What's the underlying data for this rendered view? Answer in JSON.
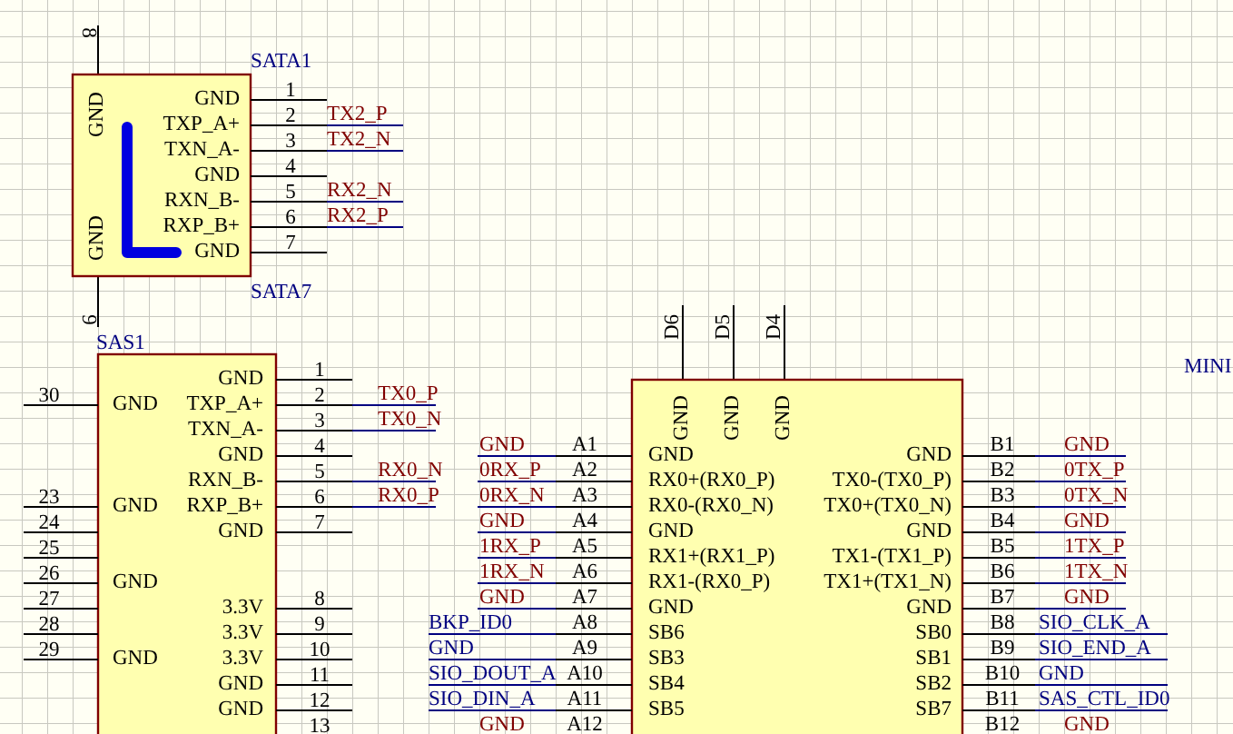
{
  "sata": {
    "designator_top": "SATA1",
    "designator_bottom": "SATA7",
    "top_pin": "8",
    "bottom_pin": "9",
    "side_labels": [
      "GND",
      "GND"
    ],
    "pins": [
      {
        "number": "1",
        "name": "GND"
      },
      {
        "number": "2",
        "name": "TXP_A+",
        "net": {
          "text": "TX2_P",
          "kind": "net_label"
        }
      },
      {
        "number": "3",
        "name": "TXN_A-",
        "net": {
          "text": "TX2_N",
          "kind": "net_label"
        }
      },
      {
        "number": "4",
        "name": "GND"
      },
      {
        "number": "5",
        "name": "RXN_B-",
        "net": {
          "text": "RX2_N",
          "kind": "net_label"
        }
      },
      {
        "number": "6",
        "name": "RXP_B+",
        "net": {
          "text": "RX2_P",
          "kind": "net_label"
        }
      },
      {
        "number": "7",
        "name": "GND"
      }
    ]
  },
  "sas": {
    "designator": "SAS1",
    "rows": [
      {
        "right": {
          "number": "1",
          "name": "GND"
        }
      },
      {
        "left": {
          "number": "30",
          "name": "GND"
        },
        "right": {
          "number": "2",
          "name": "TXP_A+",
          "net": {
            "text": "TX0_P",
            "kind": "net_label"
          }
        }
      },
      {
        "right": {
          "number": "3",
          "name": "TXN_A-",
          "net": {
            "text": "TX0_N",
            "kind": "net_label"
          }
        }
      },
      {
        "right": {
          "number": "4",
          "name": "GND"
        }
      },
      {
        "right": {
          "number": "5",
          "name": "RXN_B-",
          "net": {
            "text": "RX0_N",
            "kind": "net_label"
          }
        }
      },
      {
        "left": {
          "number": "23",
          "name": "GND"
        },
        "right": {
          "number": "6",
          "name": "RXP_B+",
          "net": {
            "text": "RX0_P",
            "kind": "net_label"
          }
        }
      },
      {
        "left": {
          "number": "24"
        },
        "right": {
          "number": "7",
          "name": "GND"
        }
      },
      {
        "left": {
          "number": "25"
        }
      },
      {
        "left": {
          "number": "26",
          "name": "GND"
        }
      },
      {
        "left": {
          "number": "27"
        },
        "right": {
          "number": "8",
          "name": "3.3V"
        }
      },
      {
        "left": {
          "number": "28"
        },
        "right": {
          "number": "9",
          "name": "3.3V"
        }
      },
      {
        "left": {
          "number": "29",
          "name": "GND"
        },
        "right": {
          "number": "10",
          "name": "3.3V"
        }
      },
      {
        "right": {
          "number": "11",
          "name": "GND"
        }
      },
      {
        "right": {
          "number": "12",
          "name": "GND"
        }
      },
      {
        "right": {
          "number": "13"
        }
      }
    ]
  },
  "minisas": {
    "title": "MINI",
    "top_pins": [
      {
        "number": "D6",
        "name": "GND"
      },
      {
        "number": "D5",
        "name": "GND"
      },
      {
        "number": "D4",
        "name": "GND"
      }
    ],
    "rows": [
      {
        "left": {
          "number": "A1",
          "name": "GND",
          "net": {
            "text": "GND",
            "kind": "net_label"
          }
        },
        "right": {
          "number": "B1",
          "name": "GND",
          "net": {
            "text": "GND",
            "kind": "net_label"
          }
        }
      },
      {
        "left": {
          "number": "A2",
          "name": "RX0+(RX0_P)",
          "net": {
            "text": "0RX_P",
            "kind": "net_label"
          }
        },
        "right": {
          "number": "B2",
          "name": "TX0-(TX0_P)",
          "net": {
            "text": "0TX_P",
            "kind": "net_label"
          }
        }
      },
      {
        "left": {
          "number": "A3",
          "name": "RX0-(RX0_N)",
          "net": {
            "text": "0RX_N",
            "kind": "net_label"
          }
        },
        "right": {
          "number": "B3",
          "name": "TX0+(TX0_N)",
          "net": {
            "text": "0TX_N",
            "kind": "net_label"
          }
        }
      },
      {
        "left": {
          "number": "A4",
          "name": "GND",
          "net": {
            "text": "GND",
            "kind": "net_label"
          }
        },
        "right": {
          "number": "B4",
          "name": "GND",
          "net": {
            "text": "GND",
            "kind": "net_label"
          }
        }
      },
      {
        "left": {
          "number": "A5",
          "name": "RX1+(RX1_P)",
          "net": {
            "text": "1RX_P",
            "kind": "net_label"
          }
        },
        "right": {
          "number": "B5",
          "name": "TX1-(TX1_P)",
          "net": {
            "text": "1TX_P",
            "kind": "net_label"
          }
        }
      },
      {
        "left": {
          "number": "A6",
          "name": "RX1-(RX0_P)",
          "net": {
            "text": "1RX_N",
            "kind": "net_label"
          }
        },
        "right": {
          "number": "B6",
          "name": "TX1+(TX1_N)",
          "net": {
            "text": "1TX_N",
            "kind": "net_label"
          }
        }
      },
      {
        "left": {
          "number": "A7",
          "name": "GND",
          "net": {
            "text": "GND",
            "kind": "net_label"
          }
        },
        "right": {
          "number": "B7",
          "name": "GND",
          "net": {
            "text": "GND",
            "kind": "net_label"
          }
        }
      },
      {
        "left": {
          "number": "A8",
          "name": "SB6",
          "net": {
            "text": "BKP_ID0",
            "kind": "text"
          }
        },
        "right": {
          "number": "B8",
          "name": "SB0",
          "net": {
            "text": "SIO_CLK_A",
            "kind": "text"
          }
        }
      },
      {
        "left": {
          "number": "A9",
          "name": "SB3",
          "net": {
            "text": "GND",
            "kind": "text"
          }
        },
        "right": {
          "number": "B9",
          "name": "SB1",
          "net": {
            "text": "SIO_END_A",
            "kind": "text"
          }
        }
      },
      {
        "left": {
          "number": "A10",
          "name": "SB4",
          "net": {
            "text": "SIO_DOUT_A",
            "kind": "text"
          }
        },
        "right": {
          "number": "B10",
          "name": "SB2",
          "net": {
            "text": "GND",
            "kind": "text"
          }
        }
      },
      {
        "left": {
          "number": "A11",
          "name": "SB5",
          "net": {
            "text": "SIO_DIN_A",
            "kind": "text"
          }
        },
        "right": {
          "number": "B11",
          "name": "SB7",
          "net": {
            "text": "SAS_CTL_ID0",
            "kind": "text"
          }
        }
      },
      {
        "left": {
          "number": "A12",
          "net": {
            "text": "GND",
            "kind": "net_label"
          }
        },
        "right": {
          "number": "B12",
          "net": {
            "text": "GND",
            "kind": "net_label"
          }
        }
      }
    ]
  }
}
